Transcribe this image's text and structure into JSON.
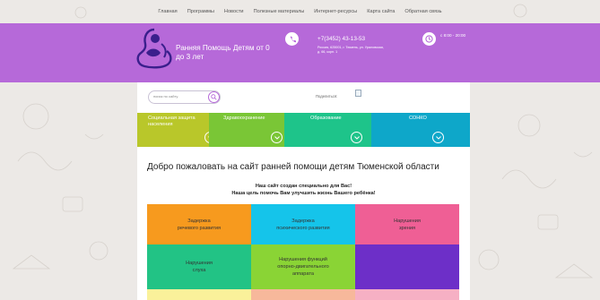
{
  "colors": {
    "header_bg": "#b669d9",
    "page_bg": "#ece9e6",
    "tab1": "#b9c72a",
    "tab2": "#7ac636",
    "tab3": "#1ec48a",
    "tab4": "#0ea7c9"
  },
  "nav": {
    "items": [
      "Главная",
      "Программы",
      "Новости",
      "Полезные материалы",
      "Интернет-ресурсы",
      "Карта сайта",
      "Обратная связь"
    ]
  },
  "header": {
    "title_line1": "Ранняя Помощь Детям от 0",
    "title_line2": "до 3 лет",
    "phone": "+7(3452) 43-13-53",
    "address_line1": "Россия, 625001, г. Тюмень, ул. Ураловская,",
    "address_line2": "д. 66, корп. 1",
    "hours": "с 8:00 - 20:00",
    "logo_icon": "mother-child-icon",
    "phone_icon": "phone-icon",
    "clock_icon": "clock-icon"
  },
  "search": {
    "placeholder": "поиск по сайту",
    "icon": "search-icon"
  },
  "share": {
    "label": "Поделиться:"
  },
  "tabs": [
    {
      "line1": "Социальная защита",
      "line2": "населения"
    },
    {
      "line1": "Здравоохранение",
      "line2": ""
    },
    {
      "line1": "Образование",
      "line2": ""
    },
    {
      "line1": "СОНКО",
      "line2": ""
    }
  ],
  "main": {
    "welcome": "Добро пожаловать на сайт ранней помощи детям Тюменской области",
    "subtitle1": "Наш сайт создан специально для Вас!",
    "subtitle2": "Наша цель помочь Вам улучшить жизнь Вашего ребёнка!"
  },
  "cells": [
    {
      "lines": [
        "Задержка",
        "речевого развития"
      ],
      "color": "#f79a1e"
    },
    {
      "lines": [
        "Задержка",
        "психического развития"
      ],
      "color": "#15c4ea"
    },
    {
      "lines": [
        "Нарушения",
        "зрения"
      ],
      "color": "#ef5f95"
    },
    {
      "lines": [
        "Нарушения",
        "слуха"
      ],
      "color": "#22c385"
    },
    {
      "lines": [
        "Нарушения функций",
        "опорно-двигательного",
        "аппарата"
      ],
      "color": "#8ad435"
    },
    {
      "lines": [],
      "color": "#6d2fc8"
    },
    {
      "lines": [],
      "color": "#faf19a"
    },
    {
      "lines": [],
      "color": "#f7b89b"
    },
    {
      "lines": [],
      "color": "#f6b0c4"
    }
  ]
}
